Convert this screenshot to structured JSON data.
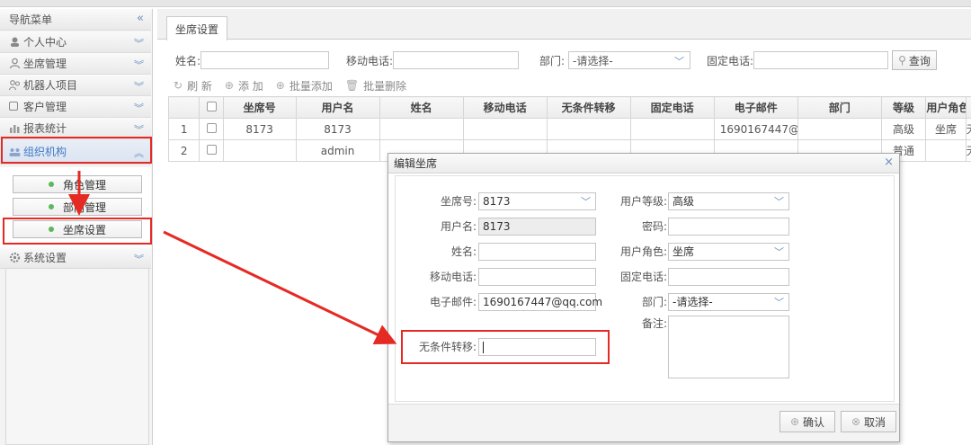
{
  "sidebar": {
    "title": "导航菜单",
    "items": [
      {
        "label": "个人中心",
        "icon": "user-circle-icon"
      },
      {
        "label": "坐席管理",
        "icon": "person-icon"
      },
      {
        "label": "机器人项目",
        "icon": "robot-icon"
      },
      {
        "label": "客户管理",
        "icon": "document-icon"
      },
      {
        "label": "报表统计",
        "icon": "chart-icon"
      },
      {
        "label": "组织机构",
        "icon": "group-icon",
        "active": true
      },
      {
        "label": "系统设置",
        "icon": "gear-icon"
      }
    ],
    "subitems": [
      {
        "label": "角色管理"
      },
      {
        "label": "部门管理"
      },
      {
        "label": "坐席设置"
      }
    ]
  },
  "main": {
    "tab": "坐席设置",
    "filters": {
      "name_label": "姓名:",
      "mobile_label": "移动电话:",
      "dept_label": "部门:",
      "dept_value": "-请选择-",
      "landline_label": "固定电话:",
      "query_label": "查询"
    },
    "toolbar": {
      "refresh": "刷 新",
      "add": "添 加",
      "batch_add": "批量添加",
      "batch_delete": "批量删除"
    },
    "table": {
      "headers": [
        "坐席号",
        "用户名",
        "姓名",
        "移动电话",
        "无条件转移",
        "固定电话",
        "电子邮件",
        "部门",
        "等级",
        "用户角色"
      ],
      "rows": [
        {
          "num": "1",
          "seat": "8173",
          "user": "8173",
          "name": "",
          "mobile": "",
          "forward": "",
          "landline": "",
          "email": "1690167447@",
          "dept": "",
          "level": "高级",
          "role": "坐席",
          "extra": "无"
        },
        {
          "num": "2",
          "seat": "",
          "user": "admin",
          "name": "",
          "mobile": "",
          "forward": "",
          "landline": "",
          "email": "",
          "dept": "",
          "level": "普通",
          "role": "",
          "extra": "无"
        }
      ]
    }
  },
  "dialog": {
    "title": "编辑坐席",
    "left": [
      {
        "label": "坐席号:",
        "value": "8173"
      },
      {
        "label": "用户名:",
        "value": "8173"
      },
      {
        "label": "姓名:",
        "value": ""
      },
      {
        "label": "移动电话:",
        "value": ""
      },
      {
        "label": "电子邮件:",
        "value": "1690167447@qq.com"
      },
      {
        "label": "无条件转移:",
        "value": ""
      }
    ],
    "right": [
      {
        "label": "用户等级:",
        "value": "高级"
      },
      {
        "label": "密码:",
        "value": ""
      },
      {
        "label": "用户角色:",
        "value": "坐席"
      },
      {
        "label": "固定电话:",
        "value": ""
      },
      {
        "label": "部门:",
        "value": "-请选择-"
      },
      {
        "label": "备注:",
        "value": ""
      }
    ],
    "confirm": "确认",
    "cancel": "取消"
  },
  "colors": {
    "highlight": "#e52a24",
    "accent": "#3f79c6"
  }
}
